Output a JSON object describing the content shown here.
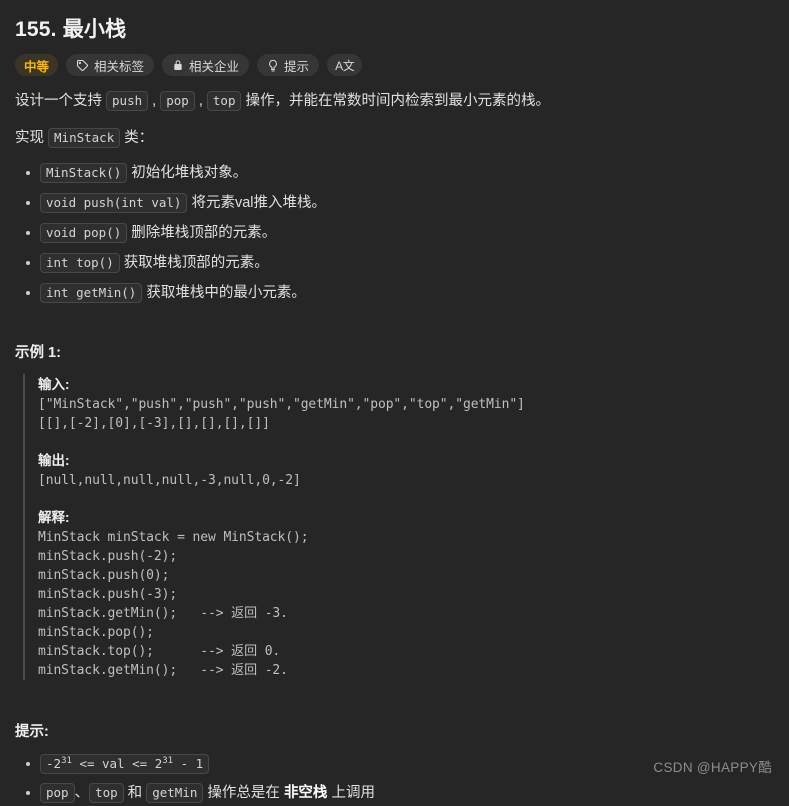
{
  "page": {
    "background": "#262626",
    "title": "155. 最小栈"
  },
  "badges": [
    {
      "label": "中等",
      "icon": "none",
      "accent": "#ffb800"
    },
    {
      "label": "相关标签",
      "icon": "tag-icon"
    },
    {
      "label": "相关企业",
      "icon": "lock-icon"
    },
    {
      "label": "提示",
      "icon": "lightbulb-icon"
    },
    {
      "label": "A文",
      "icon": "translate-icon"
    }
  ],
  "description": {
    "line1_part1": "设计一个支持 ",
    "line1_code1": "push",
    "line1_sep1": " , ",
    "line1_code2": "pop",
    "line1_sep2": " , ",
    "line1_code3": "top",
    "line1_part2": " 操作，并能在常数时间内检索到最小元素的栈。",
    "line2_part1": "实现 ",
    "line2_code": "MinStack",
    "line2_part2": " 类："
  },
  "methods": [
    {
      "code": "MinStack()",
      "text": " 初始化堆栈对象。"
    },
    {
      "code": "void push(int val)",
      "text": " 将元素val推入堆栈。"
    },
    {
      "code": "void pop()",
      "text": " 删除堆栈顶部的元素。"
    },
    {
      "code": "int top()",
      "text": " 获取堆栈顶部的元素。"
    },
    {
      "code": "int getMin()",
      "text": " 获取堆栈中的最小元素。"
    }
  ],
  "example": {
    "heading": "示例 1:",
    "input_label": "输入:",
    "input_lines": "[\"MinStack\",\"push\",\"push\",\"push\",\"getMin\",\"pop\",\"top\",\"getMin\"]\n[[],[-2],[0],[-3],[],[],[],[]]",
    "output_label": "输出:",
    "output_lines": "[null,null,null,null,-3,null,0,-2]",
    "explain_label": "解释:",
    "explain_lines": "MinStack minStack = new MinStack();\nminStack.push(-2);\nminStack.push(0);\nminStack.push(-3);\nminStack.getMin();   --> 返回 -3.\nminStack.pop();\nminStack.top();      --> 返回 0.\nminStack.getMin();   --> 返回 -2."
  },
  "hints": {
    "heading": "提示:",
    "item1": {
      "base1": "-2",
      "sup1": "31",
      "mid": " <= val <= ",
      "base2": "2",
      "sup2": "31",
      "tail": " - 1"
    },
    "item2": {
      "code1": "pop",
      "sep1": "、",
      "code2": "top",
      "sep2": " 和 ",
      "code3": "getMin",
      "text1": " 操作总是在 ",
      "emph": "非空栈",
      "text2": " 上调用"
    }
  },
  "watermark": "CSDN @HAPPY酷"
}
